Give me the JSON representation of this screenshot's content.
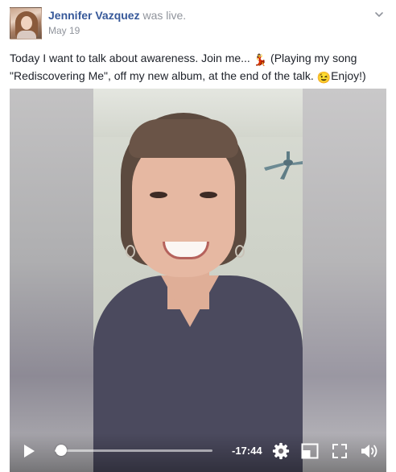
{
  "post": {
    "author": "Jennifer Vazquez",
    "action": "was live.",
    "date": "May 19",
    "text_before_emoji": "Today I want to talk about awareness. Join me... ",
    "dancer_emoji": "💃",
    "text_middle": " (Playing my song \"Rediscovering Me\", off my new album, at the end of the talk. ",
    "wink_emoji": "😉",
    "text_end": "Enjoy!)"
  },
  "video": {
    "time_remaining": "-17:44",
    "progress_fraction": 0.04
  },
  "icons": {
    "avatar": "profile-photo",
    "options": "chevron-down-icon",
    "play": "play-icon",
    "settings": "gear-icon",
    "pip": "picture-in-picture-icon",
    "fullscreen": "fullscreen-icon",
    "volume": "volume-icon"
  },
  "colors": {
    "author_link": "#365899",
    "meta_gray": "#90949c",
    "text": "#1d2129",
    "shirt": "#4b4a5e"
  }
}
